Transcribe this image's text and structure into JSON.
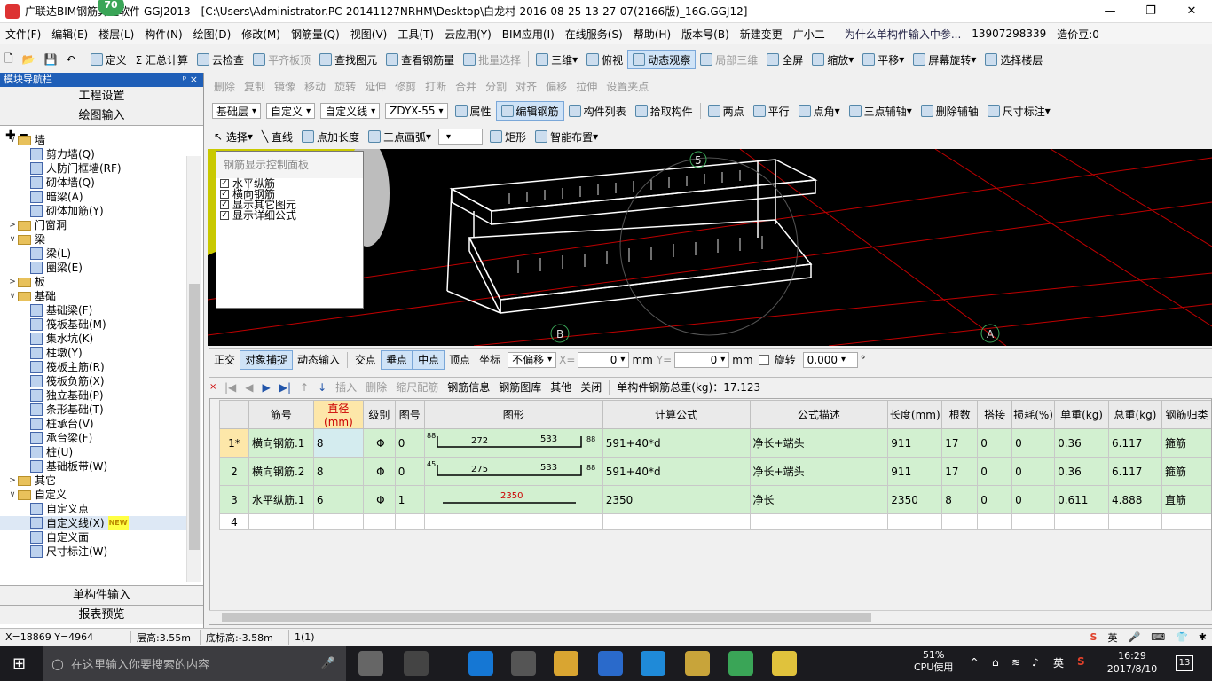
{
  "window": {
    "title": "广联达BIM钢筋算量软件 GGJ2013 - [C:\\Users\\Administrator.PC-20141127NRHM\\Desktop\\白龙村-2016-08-25-13-27-07(2166版)_16G.GGJ12]",
    "badge": "70"
  },
  "menu": {
    "items": [
      "文件(F)",
      "编辑(E)",
      "楼层(L)",
      "构件(N)",
      "绘图(D)",
      "修改(M)",
      "钢筋量(Q)",
      "视图(V)",
      "工具(T)",
      "云应用(Y)",
      "BIM应用(I)",
      "在线服务(S)",
      "帮助(H)",
      "版本号(B)"
    ],
    "new_change": "新建变更",
    "assistant": "广小二",
    "question": "为什么单构件输入中参...",
    "phone": "13907298339",
    "price": "造价豆:0"
  },
  "toolbar1": [
    "定义",
    "Σ 汇总计算",
    "云检查",
    "平齐板顶",
    "查找图元",
    "查看钢筋量",
    "批量选择",
    "三维",
    "俯视",
    "动态观察",
    "局部三维",
    "全屏",
    "缩放",
    "平移",
    "屏幕旋转",
    "选择楼层"
  ],
  "toolbar2": [
    "删除",
    "复制",
    "镜像",
    "移动",
    "旋转",
    "延伸",
    "修剪",
    "打断",
    "合并",
    "分割",
    "对齐",
    "偏移",
    "拉伸",
    "设置夹点"
  ],
  "toolbar3": {
    "layer": "基础层",
    "type1": "自定义",
    "type2": "自定义线",
    "comp": "ZDYX-55",
    "buttons": [
      "属性",
      "编辑钢筋",
      "构件列表",
      "拾取构件",
      "两点",
      "平行",
      "点角",
      "三点辅轴",
      "删除辅轴",
      "尺寸标注"
    ]
  },
  "toolbar4": [
    "选择",
    "直线",
    "点加长度",
    "三点画弧",
    "矩形",
    "智能布置"
  ],
  "leftpanel": {
    "header": "模块导航栏",
    "pin": "ᵖ ×",
    "btn1": "工程设置",
    "btn2": "绘图输入",
    "tree": [
      {
        "level": 0,
        "type": "folder",
        "label": "墙",
        "expanded": true
      },
      {
        "level": 1,
        "type": "leaf",
        "label": "剪力墙(Q)"
      },
      {
        "level": 1,
        "type": "leaf",
        "label": "人防门框墙(RF)"
      },
      {
        "level": 1,
        "type": "leaf",
        "label": "砌体墙(Q)"
      },
      {
        "level": 1,
        "type": "leaf",
        "label": "暗梁(A)"
      },
      {
        "level": 1,
        "type": "leaf",
        "label": "砌体加筋(Y)"
      },
      {
        "level": 0,
        "type": "folder",
        "label": "门窗洞",
        "expanded": false
      },
      {
        "level": 0,
        "type": "folder",
        "label": "梁",
        "expanded": true
      },
      {
        "level": 1,
        "type": "leaf",
        "label": "梁(L)"
      },
      {
        "level": 1,
        "type": "leaf",
        "label": "圈梁(E)"
      },
      {
        "level": 0,
        "type": "folder",
        "label": "板",
        "expanded": false
      },
      {
        "level": 0,
        "type": "folder",
        "label": "基础",
        "expanded": true
      },
      {
        "level": 1,
        "type": "leaf",
        "label": "基础梁(F)"
      },
      {
        "level": 1,
        "type": "leaf",
        "label": "筏板基础(M)"
      },
      {
        "level": 1,
        "type": "leaf",
        "label": "集水坑(K)"
      },
      {
        "level": 1,
        "type": "leaf",
        "label": "柱墩(Y)"
      },
      {
        "level": 1,
        "type": "leaf",
        "label": "筏板主筋(R)"
      },
      {
        "level": 1,
        "type": "leaf",
        "label": "筏板负筋(X)"
      },
      {
        "level": 1,
        "type": "leaf",
        "label": "独立基础(P)"
      },
      {
        "level": 1,
        "type": "leaf",
        "label": "条形基础(T)"
      },
      {
        "level": 1,
        "type": "leaf",
        "label": "桩承台(V)"
      },
      {
        "level": 1,
        "type": "leaf",
        "label": "承台梁(F)"
      },
      {
        "level": 1,
        "type": "leaf",
        "label": "桩(U)"
      },
      {
        "level": 1,
        "type": "leaf",
        "label": "基础板带(W)"
      },
      {
        "level": 0,
        "type": "folder",
        "label": "其它",
        "expanded": false
      },
      {
        "level": 0,
        "type": "folder",
        "label": "自定义",
        "expanded": true
      },
      {
        "level": 1,
        "type": "leaf",
        "label": "自定义点"
      },
      {
        "level": 1,
        "type": "leaf",
        "label": "自定义线(X)",
        "new": "NEW"
      },
      {
        "level": 1,
        "type": "leaf",
        "label": "自定义面"
      },
      {
        "level": 1,
        "type": "leaf",
        "label": "尺寸标注(W)"
      }
    ],
    "bottom1": "单构件输入",
    "bottom2": "报表预览"
  },
  "control_panel": {
    "title": "钢筋显示控制面板",
    "items": [
      "水平纵筋",
      "横向钢筋",
      "显示其它图元",
      "显示详细公式"
    ]
  },
  "axis_labels": [
    "5",
    "B",
    "A"
  ],
  "snapbar": {
    "items": [
      "正交",
      "对象捕捉",
      "动态输入",
      "交点",
      "垂点",
      "中点",
      "顶点",
      "坐标",
      "不偏移"
    ],
    "x_label": "X=",
    "x_value": "0",
    "y_label": "Y=",
    "y_value": "0",
    "unit": "mm",
    "rotate_label": "旋转",
    "rotate_value": "0.000",
    "degree": "°"
  },
  "rebar_toolbar": {
    "items": [
      "插入",
      "删除",
      "缩尺配筋",
      "钢筋信息",
      "钢筋图库",
      "其他",
      "关闭"
    ],
    "total": "单构件钢筋总重(kg)：17.123"
  },
  "table": {
    "headers": [
      "",
      "筋号",
      "直径(mm)",
      "级别",
      "图号",
      "图形",
      "计算公式",
      "公式描述",
      "长度(mm)",
      "根数",
      "搭接",
      "损耗(%)",
      "单重(kg)",
      "总重(kg)",
      "钢筋归类"
    ],
    "rows": [
      {
        "no": "1*",
        "name": "横向钢筋.1",
        "dia": "8",
        "grade": "Φ",
        "fig": "0",
        "shape": "272 / 533",
        "formula": "591+40*d",
        "desc": "净长+端头",
        "len": "911",
        "count": "17",
        "lap": "0",
        "loss": "0",
        "uw": "0.36",
        "tw": "6.117",
        "cat": "箍筋"
      },
      {
        "no": "2",
        "name": "横向钢筋.2",
        "dia": "8",
        "grade": "Φ",
        "fig": "0",
        "shape": "275 / 533",
        "formula": "591+40*d",
        "desc": "净长+端头",
        "len": "911",
        "count": "17",
        "lap": "0",
        "loss": "0",
        "uw": "0.36",
        "tw": "6.117",
        "cat": "箍筋"
      },
      {
        "no": "3",
        "name": "水平纵筋.1",
        "dia": "6",
        "grade": "Φ",
        "fig": "1",
        "shape": "2350",
        "formula": "2350",
        "desc": "净长",
        "len": "2350",
        "count": "8",
        "lap": "0",
        "loss": "0",
        "uw": "0.611",
        "tw": "4.888",
        "cat": "直筋"
      },
      {
        "no": "4",
        "name": "",
        "dia": "",
        "grade": "",
        "fig": "",
        "shape": "",
        "formula": "",
        "desc": "",
        "len": "",
        "count": "",
        "lap": "",
        "loss": "",
        "uw": "",
        "tw": "",
        "cat": ""
      }
    ],
    "shape_marks": {
      "a": "88",
      "b": "45"
    }
  },
  "statusbar": [
    "X=18869 Y=4964",
    "层高:3.55m",
    "底标高:-3.58m",
    "1(1)"
  ],
  "taskbar": {
    "search_placeholder": "在这里输入你要搜索的内容",
    "cpu_pct": "51%",
    "cpu_label": "CPU使用",
    "time": "16:29",
    "date": "2017/8/10",
    "ime": "英",
    "notif": "13"
  },
  "colors": {
    "accent": "#1f5fb8",
    "grid_row": "#d2f0d0",
    "canvas_bg": "#000000",
    "rebar_red": "#cc0000"
  }
}
